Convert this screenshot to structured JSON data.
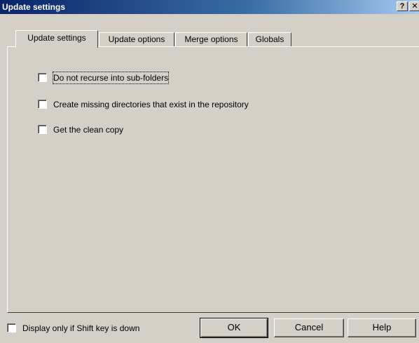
{
  "window": {
    "title": "Update settings",
    "help_glyph": "?",
    "close_glyph": "✕"
  },
  "tabs": [
    {
      "label": "Update settings",
      "active": true
    },
    {
      "label": "Update options",
      "active": false
    },
    {
      "label": "Merge options",
      "active": false
    },
    {
      "label": "Globals",
      "active": false
    }
  ],
  "options": [
    {
      "label": "Do not recurse into sub-folders",
      "checked": false
    },
    {
      "label": "Create missing directories that exist in the repository",
      "checked": false
    },
    {
      "label": "Get the clean copy",
      "checked": false
    }
  ],
  "footer": {
    "shift_label": "Display only if Shift key is down",
    "ok_label": "OK",
    "cancel_label": "Cancel",
    "help_label": "Help"
  }
}
